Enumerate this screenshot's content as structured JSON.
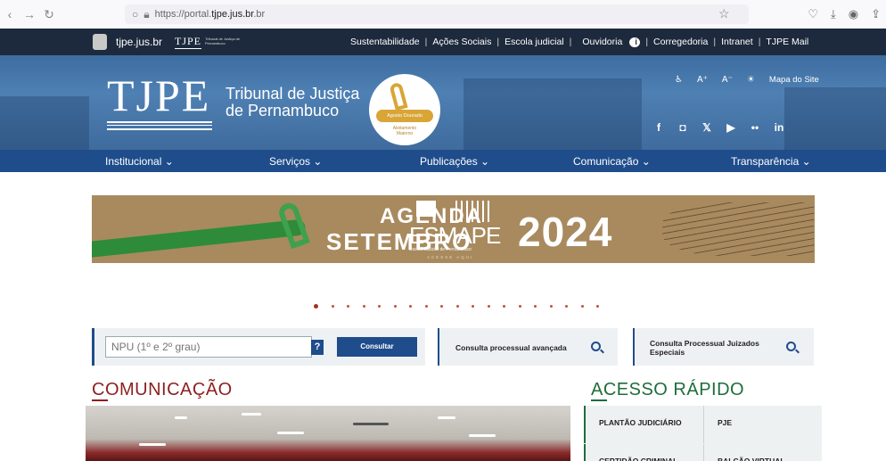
{
  "browser": {
    "url_prefix": "https://portal.",
    "url_domain": "tjpe.jus.br"
  },
  "topbar": {
    "site_label": "tjpe.jus.br",
    "mini_logo": "TJPE",
    "mini_sub": "Tribunal de Justiça de Pernambuco",
    "links": [
      "Sustentabilidade",
      "Ações Sociais",
      "Escola judicial",
      "Ouvidoria",
      "Corregedoria",
      "Intranet",
      "TJPE Mail"
    ]
  },
  "header": {
    "logo": "TJPE",
    "tribunal_line1": "Tribunal de Justiça",
    "tribunal_line2": "de Pernambuco",
    "badge_title": "Agosto Dourado",
    "badge_sub1": "Aleitamento",
    "badge_sub2": "Materno",
    "font_up": "A⁺",
    "font_down": "A⁻",
    "map_label": "Mapa do Site",
    "socials": [
      "f",
      "◘",
      "𝕏",
      "▶",
      "••",
      "in"
    ]
  },
  "nav": {
    "items": [
      "Institucional ⌄",
      "Serviços ⌄",
      "Publicações ⌄",
      "Comunicação ⌄",
      "Transparência ⌄"
    ]
  },
  "agenda": {
    "line1": "AGENDA",
    "line2": "SETEMBRO",
    "brand": "ESMAPE",
    "brand_sub": "Escola Judicial de Pernambuco",
    "brand_cta": "ACESSE AQUI",
    "year": "2024"
  },
  "search": {
    "npu_placeholder": "NPU (1º e 2º grau)",
    "help": "?",
    "consultar": "Consultar",
    "advanced": "Consulta processual avançada",
    "juizados": "Consulta Processual Juizados Especiais"
  },
  "sections": {
    "comunicacao": "COMUNICAÇÃO",
    "acesso": "ACESSO RÁPIDO"
  },
  "acesso_items": [
    "PLANTÃO JUDICIÁRIO",
    "PJE",
    "CERTIDÃO CRIMINAL",
    "BALCÃO VIRTUAL"
  ],
  "colors": {
    "nav_blue": "#1f4c8b",
    "top_dark": "#1d2a3d",
    "com_red": "#8d1f1f",
    "acc_green": "#1e6d3a",
    "agenda_tan": "#a88a5e"
  }
}
